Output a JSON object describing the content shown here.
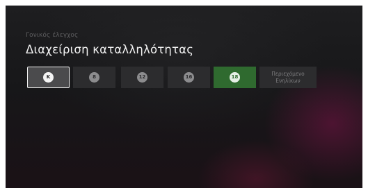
{
  "header": {
    "breadcrumb": "Γονικός έλεγχος",
    "title": "Διαχείριση καταλληλότητας"
  },
  "rating_options": [
    {
      "label": "K",
      "state": "focused"
    },
    {
      "label": "8",
      "state": "default"
    },
    {
      "label": "12",
      "state": "default"
    },
    {
      "label": "16",
      "state": "default"
    },
    {
      "label": "18",
      "state": "selected"
    },
    {
      "label_line1": "Περιεχόμενο",
      "label_line2": "Ενηλίκων",
      "state": "default"
    }
  ],
  "colors": {
    "background": "#19181a",
    "tile": "#2c2c2e",
    "focused_tile": "#4b4b4d",
    "selected_tile": "#2f6a2f",
    "focus_border": "#f4f4f4",
    "title_text": "#f2f2f2",
    "breadcrumb_text": "#5e5e60"
  }
}
